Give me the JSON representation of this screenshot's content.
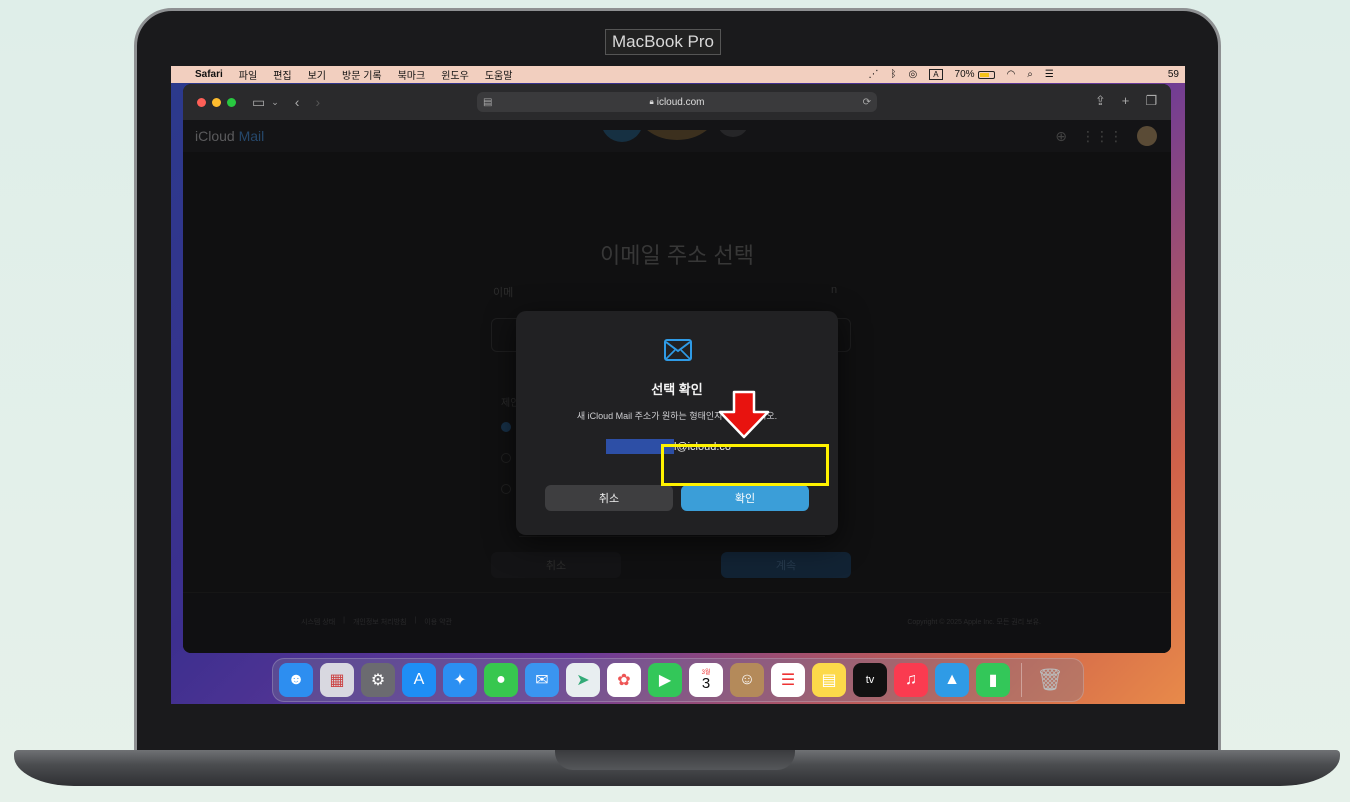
{
  "device": {
    "label": "MacBook Pro"
  },
  "menubar": {
    "app": "Safari",
    "items": [
      "파일",
      "편집",
      "보기",
      "방문 기록",
      "북마크",
      "윈도우",
      "도움말"
    ],
    "battery_percent": "70%",
    "input_source": "A",
    "clock_fragment": "59"
  },
  "safari": {
    "url": "icloud.com"
  },
  "page": {
    "app_title_prefix": "iCloud",
    "app_title_suffix": " Mail",
    "background_heading": "이메일 주소 선택",
    "background_sub_left": "이메",
    "background_sub_right": "n",
    "background_label": "제안",
    "background_cancel": "취소",
    "background_next": "계속",
    "footer_links": [
      "시스템 상태",
      "개인정보 처리방침",
      "이용 약관"
    ],
    "footer_copyright": "Copyright © 2025 Apple Inc. 모든 권리 보유."
  },
  "modal": {
    "title": "선택 확인",
    "description": "새 iCloud Mail 주소가 원하는 형태인지 확인하십시오.",
    "email_visible": "l@icloud.co",
    "cancel_label": "취소",
    "confirm_label": "확인"
  },
  "annotation": {
    "highlight_color": "#fff200",
    "arrow_color": "#e8130f"
  },
  "dock": {
    "calendar_month": "3월",
    "calendar_day": "3",
    "tv_label": "tv"
  }
}
